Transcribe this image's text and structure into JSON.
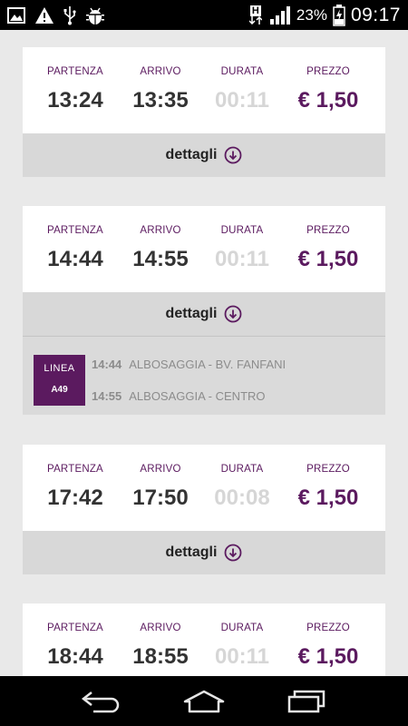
{
  "status_bar": {
    "icons_left": [
      "image-icon",
      "warning-icon",
      "usb-icon",
      "android-debug-icon"
    ],
    "network_label": "H",
    "battery_percent": "23%",
    "time": "09:17"
  },
  "labels": {
    "departure": "PARTENZA",
    "arrival": "ARRIVO",
    "duration": "DURATA",
    "price": "PREZZO",
    "details": "dettagli",
    "line": "LINEA"
  },
  "trips": [
    {
      "departure": "13:24",
      "arrival": "13:35",
      "duration": "00:11",
      "price": "€ 1,50"
    },
    {
      "departure": "14:44",
      "arrival": "14:55",
      "duration": "00:11",
      "price": "€ 1,50",
      "expanded": true,
      "line_code": "A49",
      "legs": [
        {
          "time": "14:44",
          "stop": "ALBOSAGGIA - BV. FANFANI"
        },
        {
          "time": "14:55",
          "stop": "ALBOSAGGIA - CENTRO"
        }
      ]
    },
    {
      "departure": "17:42",
      "arrival": "17:50",
      "duration": "00:08",
      "price": "€ 1,50"
    },
    {
      "departure": "18:44",
      "arrival": "18:55",
      "duration": "00:11",
      "price": "€ 1,50"
    }
  ],
  "colors": {
    "accent": "#5b1a5f",
    "muted": "#d6d6d6",
    "panel": "#d8d8d8",
    "background": "#e9e9e9"
  },
  "nav_bar": {
    "buttons": [
      "back-icon",
      "home-icon",
      "recent-apps-icon"
    ]
  }
}
